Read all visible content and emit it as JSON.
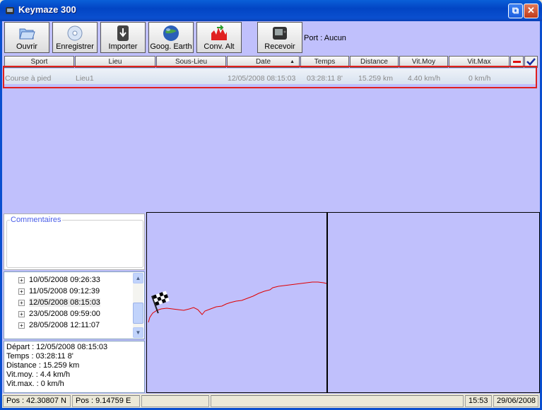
{
  "window": {
    "title": "Keymaze 300",
    "restore_glyph": "⧉",
    "close_glyph": "✕"
  },
  "toolbar": {
    "buttons": [
      {
        "label": "Ouvrir",
        "icon": "folder-icon"
      },
      {
        "label": "Enregistrer",
        "icon": "disc-icon"
      },
      {
        "label": "Importer",
        "icon": "import-icon"
      },
      {
        "label": "Goog. Earth",
        "icon": "globe-icon"
      },
      {
        "label": "Conv. Alt",
        "icon": "altitude-chart-icon"
      },
      {
        "label": "Recevoir",
        "icon": "gps-device-icon"
      }
    ],
    "port_label": "Port : Aucun"
  },
  "table": {
    "headers": [
      "Sport",
      "Lieu",
      "Sous-Lieu",
      "Date",
      "Temps",
      "Distance",
      "Vit.Moy",
      "Vit.Max"
    ],
    "sort_indicator": "▲",
    "row": {
      "sport": "Course à pied",
      "lieu": "Lieu1",
      "sous_lieu": "",
      "date": "12/05/2008 08:15:03",
      "temps": "03:28:11 8'",
      "distance": "15.259 km",
      "vit_moy": "4.40 km/h",
      "vit_max": "0 km/h"
    }
  },
  "comments": {
    "legend": "Commentaires"
  },
  "tree": {
    "items": [
      {
        "label": "10/05/2008 09:26:33",
        "expander": "+"
      },
      {
        "label": "11/05/2008 09:12:39",
        "expander": "+"
      },
      {
        "label": "12/05/2008 08:15:03",
        "expander": "+"
      },
      {
        "label": "23/05/2008 09:59:00",
        "expander": "+"
      },
      {
        "label": "28/05/2008 12:11:07",
        "expander": "+"
      }
    ],
    "selected_index": 2,
    "scroll_up": "▲",
    "scroll_down": "▼"
  },
  "info": {
    "depart": "Départ : 12/05/2008 08:15:03",
    "temps": "Temps : 03:28:11 8'",
    "distance": "Distance : 15.259 km",
    "vit_moy": "Vit.moy. : 4.4 km/h",
    "vit_max": "Vit.max. : 0 km/h"
  },
  "status": {
    "pos_n": "Pos : 42.30807 N",
    "pos_e": "Pos : 9.14759 E",
    "time": "15:53",
    "date": "29/06/2008"
  },
  "colors": {
    "client_bg": "#c0c0fc",
    "selection_border": "#e0201e",
    "track_line": "#e00000",
    "title_bar": "#0245c4"
  }
}
